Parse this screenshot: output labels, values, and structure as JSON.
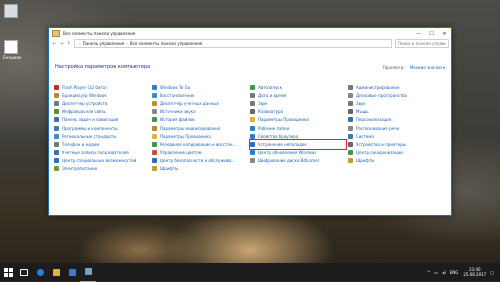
{
  "desktop": {
    "icons": [
      {
        "label": ""
      },
      {
        "label": "Безымян"
      }
    ]
  },
  "window": {
    "title": "Все элементы панели управления",
    "buttons": {
      "minimize": "—",
      "maximize": "☐",
      "close": "✕"
    },
    "address": {
      "crumbs": [
        "Панель управления",
        "Все элементы панели управления"
      ],
      "search_placeholder": "Поиск в панели управления"
    },
    "page_title": "Настройка параметров компьютера",
    "view_by_label": "Просмотр:",
    "view_by_value": "Мелкие значки ▾",
    "columns": [
      [
        {
          "label": "Flash Player (32 бита)",
          "color": "#c0302b"
        },
        {
          "label": "Брандмауэр Windows",
          "color": "#c0862b"
        },
        {
          "label": "Диспетчер устройств",
          "color": "#6b7b8a"
        },
        {
          "label": "Инфракрасная связь",
          "color": "#5a8f3a"
        },
        {
          "label": "Панель задач и навигация",
          "color": "#3a6fb0"
        },
        {
          "label": "Программы и компоненты",
          "color": "#4a7ab5"
        },
        {
          "label": "Региональные стандарты",
          "color": "#3a8fd0"
        },
        {
          "label": "Телефон и модем",
          "color": "#777777"
        },
        {
          "label": "Учетные записи пользователей",
          "color": "#3a6fb0"
        },
        {
          "label": "Центр специальных возможностей",
          "color": "#2a6fc0"
        },
        {
          "label": "Электропитание",
          "color": "#6aa032"
        }
      ],
      [
        {
          "label": "Windows To Go",
          "color": "#2a7fd0"
        },
        {
          "label": "Восстановление",
          "color": "#3a8fc0"
        },
        {
          "label": "Диспетчер учетных данных",
          "color": "#c0902b"
        },
        {
          "label": "Источники звука",
          "color": "#888888"
        },
        {
          "label": "История файлов",
          "color": "#3a9a4a"
        },
        {
          "label": "Параметры индексирования",
          "color": "#c0862b"
        },
        {
          "label": "Параметры Проводника",
          "color": "#e0b040"
        },
        {
          "label": "Резервное копирование и восстан…",
          "color": "#3a9a4a"
        },
        {
          "label": "Управление цветом",
          "color": "#d05030"
        },
        {
          "label": "Центр безопасности и обслужива…",
          "color": "#2a6fc0"
        },
        {
          "label": "Шрифты",
          "color": "#c0a030"
        }
      ],
      [
        {
          "label": "Автозапуск",
          "color": "#3a9a4a"
        },
        {
          "label": "Дата и время",
          "color": "#6b7b8a"
        },
        {
          "label": "Звук",
          "color": "#777777"
        },
        {
          "label": "Клавиатура",
          "color": "#666666"
        },
        {
          "label": "Параметры Проводника",
          "color": "#e0b040"
        },
        {
          "label": "Рабочие папки",
          "color": "#2a7fd0"
        },
        {
          "label": "Свойства браузера",
          "color": "#2a7fd0"
        },
        {
          "label": "Устранение неполадок",
          "color": "#2a6fc0"
        },
        {
          "label": "Центр обновления Windows",
          "color": "#2a7fd0"
        },
        {
          "label": "Шифрование диска BitLocker",
          "color": "#888888"
        }
      ],
      [
        {
          "label": "Администрирование",
          "color": "#6b7b8a"
        },
        {
          "label": "Дисковые пространства",
          "color": "#888888"
        },
        {
          "label": "Звук",
          "color": "#777777"
        },
        {
          "label": "Мышь",
          "color": "#666666"
        },
        {
          "label": "Персонализация",
          "color": "#3a6fb0"
        },
        {
          "label": "Распознавание речи",
          "color": "#888888"
        },
        {
          "label": "Система",
          "color": "#3a7ab0"
        },
        {
          "label": "Устройства и принтеры",
          "color": "#666666"
        },
        {
          "label": "Центр синхронизации",
          "color": "#3a9a4a"
        },
        {
          "label": "Шрифты",
          "color": "#c0a030"
        }
      ]
    ],
    "highlighted": "Устранение неполадок"
  },
  "taskbar": {
    "tray": {
      "lang": "ENG",
      "time": "23:40",
      "date": "25.08.2017"
    }
  }
}
